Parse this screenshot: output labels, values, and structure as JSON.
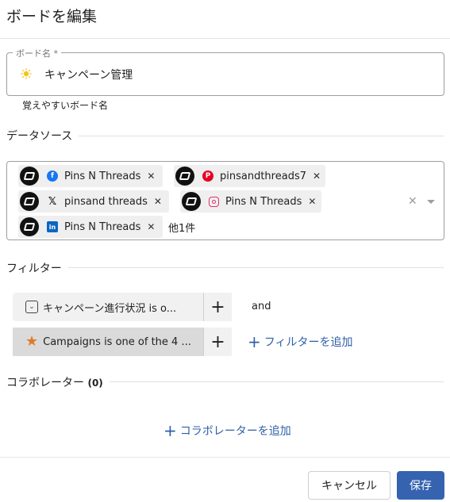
{
  "dialog": {
    "title": "ボードを編集"
  },
  "board_name": {
    "label": "ボード名 *",
    "value": "キャンペーン管理",
    "helper": "覚えやすいボード名",
    "emoji": "sun-emoji-icon"
  },
  "datasource": {
    "section_title": "データソース",
    "chips": [
      {
        "label": "Pins N Threads",
        "platform": "facebook-icon"
      },
      {
        "label": "pinsandthreads7",
        "platform": "pinterest-icon"
      },
      {
        "label": "pinsand threads",
        "platform": "x-icon"
      },
      {
        "label": "Pins N Threads",
        "platform": "instagram-icon"
      },
      {
        "label": "Pins N Threads",
        "platform": "linkedin-icon"
      }
    ],
    "remove_glyph": "✕",
    "more_text": "他1件",
    "clear_glyph": "✕"
  },
  "filters": {
    "section_title": "フィルター",
    "items": [
      {
        "label": "キャンペーン進行状況 is o...",
        "icon": "select-field-icon"
      },
      {
        "label": "Campaigns is one of the 4 ...",
        "icon": "star-icon"
      }
    ],
    "and_text": "and",
    "add_label": "フィルターを追加"
  },
  "collaborators": {
    "section_title": "コラボレーター",
    "count": "(0)",
    "add_label": "コラボレーターを追加"
  },
  "footer": {
    "cancel_label": "キャンセル",
    "save_label": "保存"
  },
  "colors": {
    "accent": "#3563b0",
    "link": "#2d5fa8",
    "star": "#e07b24"
  }
}
